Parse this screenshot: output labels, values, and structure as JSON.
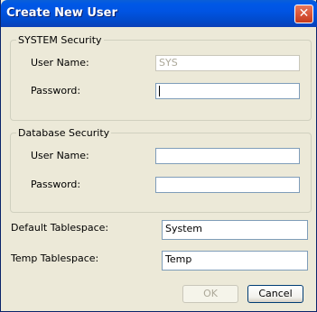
{
  "window": {
    "title": "Create New User"
  },
  "system_security": {
    "legend": "SYSTEM Security",
    "username_label": "User Name:",
    "username_value": "SYS",
    "password_label": "Password:",
    "password_value": ""
  },
  "database_security": {
    "legend": "Database Security",
    "username_label": "User Name:",
    "username_value": "",
    "password_label": "Password:",
    "password_value": ""
  },
  "tablespaces": {
    "default_label": "Default Tablespace:",
    "default_value": "System",
    "temp_label": "Temp Tablespace:",
    "temp_value": "Temp"
  },
  "buttons": {
    "ok": "OK",
    "cancel": "Cancel"
  }
}
